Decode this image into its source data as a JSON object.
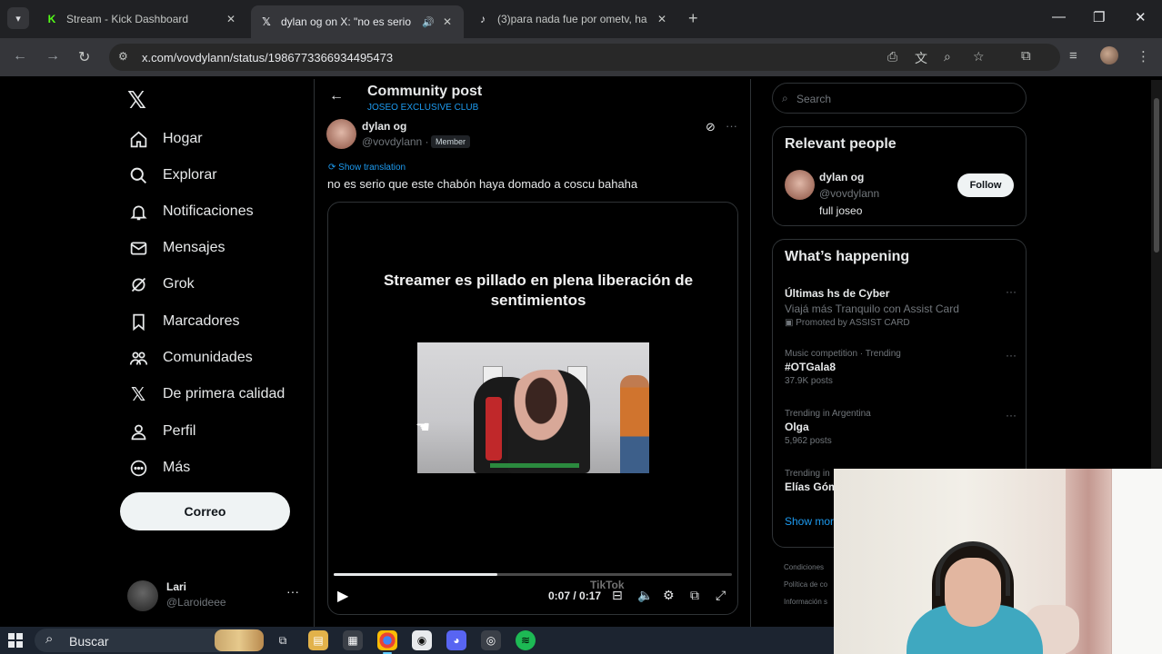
{
  "browser": {
    "tabs": [
      {
        "title": "Stream - Kick Dashboard",
        "close": "✕"
      },
      {
        "title": "dylan og on X: \"no es serio",
        "close": "✕"
      },
      {
        "title": "(3)para nada fue por ometv, ha",
        "close": "✕"
      }
    ],
    "new_tab": "+",
    "url": "x.com/vovdylann/status/1986773366934495473"
  },
  "sidebar": {
    "items": [
      {
        "label": "Hogar"
      },
      {
        "label": "Explorar"
      },
      {
        "label": "Notificaciones"
      },
      {
        "label": "Mensajes"
      },
      {
        "label": "Grok"
      },
      {
        "label": "Marcadores"
      },
      {
        "label": "Comunidades"
      },
      {
        "label": "De primera calidad"
      },
      {
        "label": "Perfil"
      },
      {
        "label": "Más"
      }
    ],
    "post_button": "Correo",
    "account": {
      "name": "Lari",
      "handle": "@Laroideee"
    }
  },
  "main": {
    "header_title": "Community post",
    "header_subtitle": "JOSEO EXCLUSIVE CLUB",
    "post": {
      "author_name": "dylan og",
      "author_handle": "@vovdylann ·",
      "badge": "Member",
      "translate": "Show translation",
      "text": "no es serio que este chabón haya domado a coscu bahaha",
      "video_caption": "Streamer es pillado en plena liberación de sentimientos",
      "time": "0:07 / 0:17",
      "watermark": "TikTok",
      "progress": 0.41
    }
  },
  "right": {
    "search_placeholder": "Search",
    "relevant": {
      "title": "Relevant people",
      "name": "dylan og",
      "handle": "@vovdylann",
      "bio": "full joseo",
      "follow": "Follow"
    },
    "happening": {
      "title": "What’s happening",
      "trends": [
        {
          "title": "Últimas hs de Cyber",
          "desc": "Viajá más Tranquilo con Assist Card",
          "sub": "Promoted by ASSIST CARD"
        },
        {
          "meta": "Music competition · Trending",
          "title": "#OTGala8",
          "sub": "37.9K posts"
        },
        {
          "meta": "Trending in Argentina",
          "title": "Olga",
          "sub": "5,962 posts"
        },
        {
          "meta": "Trending in",
          "title": "Elías Góm"
        }
      ],
      "show_more": "Show mor"
    },
    "footer": [
      "Condiciones",
      "Política de co",
      "Información s"
    ]
  },
  "taskbar": {
    "search": "Buscar"
  }
}
